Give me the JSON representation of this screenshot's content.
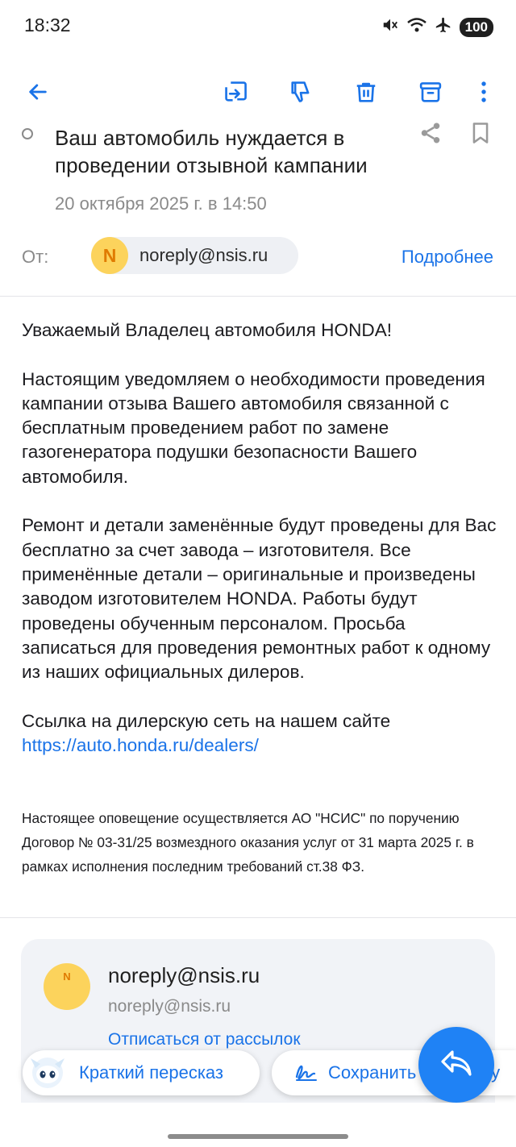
{
  "status_bar": {
    "time": "18:32",
    "battery": "100",
    "icons": [
      "mute-icon",
      "wifi-icon",
      "airplane-icon"
    ]
  },
  "toolbar": {
    "buttons": [
      "back-arrow-icon",
      "move-to-folder-icon",
      "dislike-icon",
      "trash-icon",
      "archive-icon",
      "more-vert-icon"
    ],
    "accent_color": "#1a73e8"
  },
  "message": {
    "subject": "Ваш автомобиль нуждается в проведении отзывной кампании",
    "date": "20 октября 2025 г. в 14:50",
    "from_label": "От:",
    "sender_initial": "N",
    "sender_email": "noreply@nsis.ru",
    "details_link": "Подробнее"
  },
  "body": {
    "greeting": "Уважаемый Владелец автомобиля HONDA!",
    "paragraph1": "Настоящим уведомляем о необходимости проведения кампании отзыва Вашего автомобиля связанной с бесплатным проведением работ по замене газогенератора подушки безопасности Вашего автомобиля.",
    "paragraph2": "Ремонт и детали заменённые будут проведены для Вас бесплатно за счет завода – изготовителя. Все применённые детали – оригинальные и произведены заводом изготовителем HONDA. Работы будут проведены обученным персоналом. Просьба записаться для проведения ремонтных работ к одному из наших официальных дилеров.",
    "link_intro": "Ссылка на дилерскую сеть на нашем сайте",
    "link_url": "https://auto.honda.ru/dealers/",
    "footer_note": "Настоящее оповещение осуществляется АО \"НСИС\" по поручению Договор № 03-31/25 возмездного оказания услуг от 31 марта 2025 г. в рамках исполнения последним требований ст.38 ФЗ."
  },
  "sender_card": {
    "avatar_initial": "N",
    "name": "noreply@nsis.ru",
    "email": "noreply@nsis.ru",
    "unsubscribe": "Отписаться от рассылок"
  },
  "actions": {
    "summary_label": "Краткий пересказ",
    "save_label": "Сохранить в заметку"
  }
}
